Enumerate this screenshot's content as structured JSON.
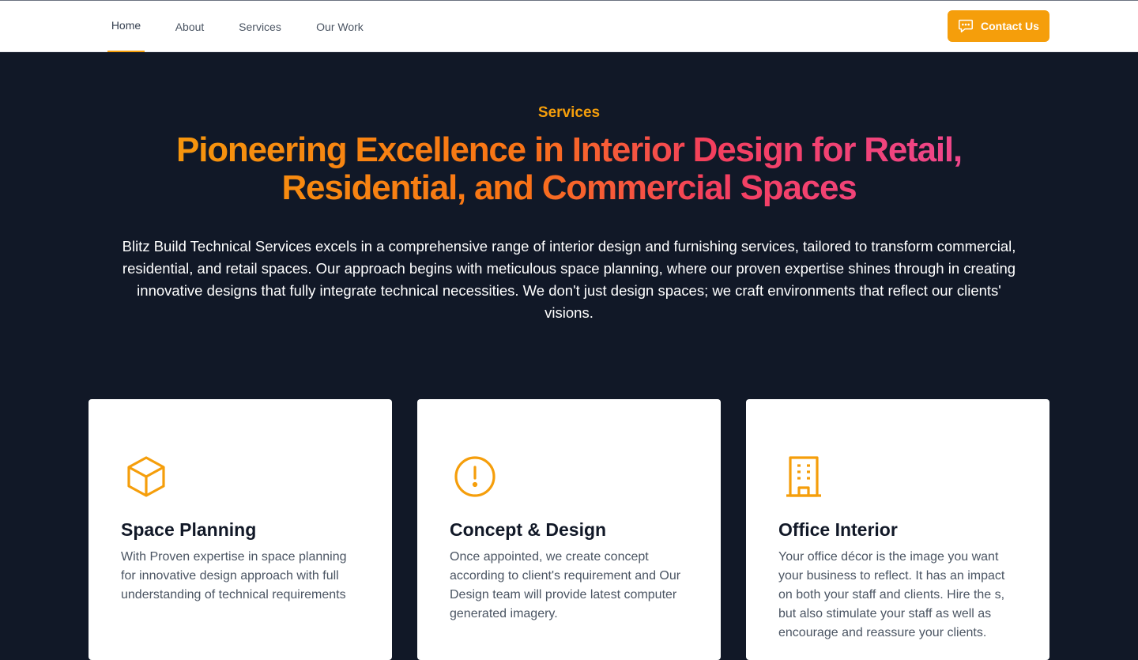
{
  "nav": {
    "items": [
      {
        "label": "Home",
        "active": true
      },
      {
        "label": "About",
        "active": false
      },
      {
        "label": "Services",
        "active": false
      },
      {
        "label": "Our Work",
        "active": false
      }
    ],
    "contact_label": "Contact Us",
    "contact_icon": "chat-bubble-icon"
  },
  "hero": {
    "eyebrow": "Services",
    "headline": "Pioneering Excellence in Interior Design for Retail, Residential, and Commercial Spaces",
    "intro": "Blitz Build Technical Services excels in a comprehensive range of interior design and furnishing services, tailored to transform commercial, residential, and retail spaces. Our approach begins with meticulous space planning, where our proven expertise shines through in creating innovative designs that fully integrate technical necessities. We don't just design spaces; we craft environments that reflect our clients' visions."
  },
  "cards": [
    {
      "icon": "cube-icon",
      "title": "Space Planning",
      "description": "With Proven expertise in space planning for innovative design approach with full understanding of technical requirements"
    },
    {
      "icon": "exclamation-circle-icon",
      "title": "Concept & Design",
      "description": "Once appointed, we create concept according to client's requirement and Our Design team will provide latest computer generated imagery."
    },
    {
      "icon": "office-building-icon",
      "title": "Office Interior",
      "description": "Your office décor is the image you want your business to reflect. It has an impact on both your staff and clients. Hire the s, but also stimulate your staff as well as encourage and reassure your clients."
    }
  ],
  "colors": {
    "accent": "#f59e0b",
    "background": "#111827",
    "gradient": [
      "#f59e0b",
      "#f97316",
      "#f43f5e",
      "#ec4899"
    ]
  }
}
